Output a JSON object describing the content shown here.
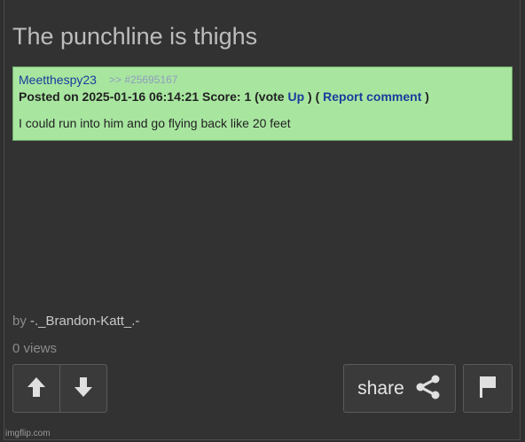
{
  "post": {
    "title": "The punchline is thighs"
  },
  "comment": {
    "username": "Meetthespy23",
    "post_ref": ">> #25695167",
    "posted_prefix": "Posted on 2025-01-16 06:14:21 Score: 1 (vote",
    "vote_link": "Up",
    "posted_mid": ") (",
    "report_link": "Report comment",
    "posted_suffix": ")",
    "text": "I could run into him and go flying back like 20 feet"
  },
  "byline": {
    "prefix": "by",
    "author": "-._Brandon-Katt_.-"
  },
  "views": "0 views",
  "actions": {
    "share_label": "share"
  },
  "icons": {
    "upvote": "arrow-up-icon",
    "downvote": "arrow-down-icon",
    "share": "share-icon",
    "flag": "flag-icon"
  },
  "colors": {
    "comment_bg": "#a8e6a0",
    "link_blue": "#1a3a9c"
  },
  "watermark": "imgflip.com"
}
